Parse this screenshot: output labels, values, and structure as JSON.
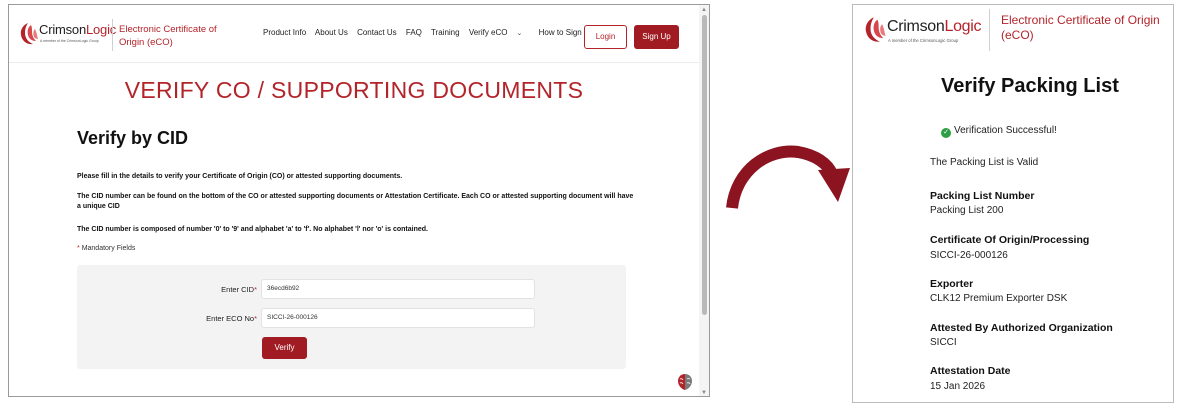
{
  "left": {
    "brand": {
      "logo_word_1": "Crimson",
      "logo_word_2": "Logic",
      "logo_sub": "A member of the CrimsonLogic Group",
      "title": "Electronic Certificate of Origin (eCO)"
    },
    "nav": {
      "items": [
        "Product Info",
        "About Us",
        "Contact Us",
        "FAQ",
        "Training",
        "Verify eCO",
        "How to Sign Up"
      ],
      "login": "Login",
      "signup": "Sign Up"
    },
    "hero_title": "VERIFY CO / SUPPORTING DOCUMENTS",
    "section_title": "Verify by CID",
    "paragraphs": [
      "Please fill in the details to verify your Certificate of Origin (CO) or attested supporting documents.",
      "The CID number can be found on the bottom of the CO or attested supporting documents or Attestation Certificate. Each CO or attested supporting document will have a unique CID",
      "The CID number is composed of number '0' to '9' and alphabet 'a' to 'f'. No alphabet 'l' nor 'o' is contained."
    ],
    "mandatory_note": "Mandatory Fields",
    "form": {
      "cid_label": "Enter CID",
      "cid_value": "36ecd6b92",
      "eco_label": "Enter ECO No",
      "eco_value": "SICCI-26-000126",
      "verify_label": "Verify"
    }
  },
  "right": {
    "brand": {
      "logo_word_1": "Crimson",
      "logo_word_2": "Logic",
      "logo_sub": "A member of the CrimsonLogic Group",
      "title": "Electronic Certificate of Origin (eCO)"
    },
    "title": "Verify Packing List",
    "success": "Verification Successful!",
    "valid_text": "The Packing List is Valid",
    "fields": [
      {
        "label": "Packing List Number",
        "value": "Packing List 200"
      },
      {
        "label": "Certificate Of Origin/Processing",
        "value": "SICCI-26-000126"
      },
      {
        "label": "Exporter",
        "value": "CLK12 Premium Exporter DSK"
      },
      {
        "label": "Attested By Authorized Organization",
        "value": "SICCI"
      },
      {
        "label": "Attestation Date",
        "value": "15 Jan 2026"
      }
    ]
  },
  "colors": {
    "accent": "#b3242a",
    "button": "#a01b22",
    "success": "#2e9e44"
  },
  "icons": [
    "crimsonlogic-logo",
    "chevron-down-icon",
    "brain-icon",
    "check-circle-icon",
    "curved-arrow-icon"
  ]
}
